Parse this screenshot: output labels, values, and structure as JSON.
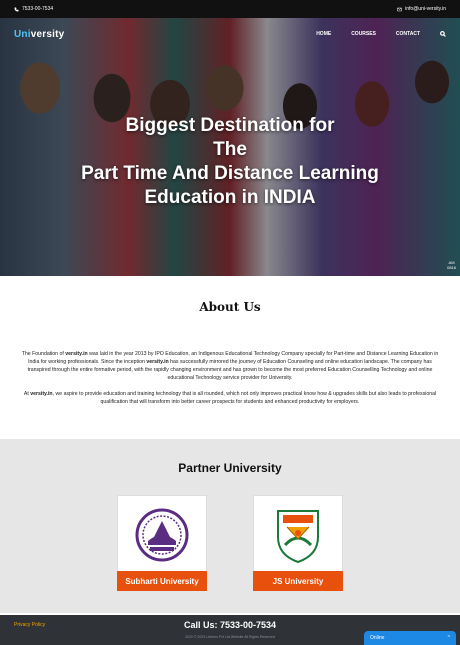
{
  "topbar": {
    "phone": "7533-00-7534",
    "email": "info@uni-versity.in"
  },
  "nav": {
    "logo_accent": "Uni",
    "logo_rest": "versity",
    "items": [
      "HOME",
      "COURSES",
      "CONTACT"
    ]
  },
  "hero": {
    "headline_lines": [
      "Biggest Destination for",
      "The",
      "Part Time And Distance Learning",
      "Education in INDIA"
    ],
    "badge_line1": "AM",
    "badge_line2": "0816"
  },
  "about": {
    "title": "About Us",
    "p1_prefix": "The Foundation of ",
    "p1_brand": "versity.in",
    "p1_mid": " was laid in the year 2013 by IPO Education, an Indigenous Educational Technology Company specially for Part-time and Distance Learning Education in India for working professionals. Since the inception ",
    "p1_brand2": "versity.in",
    "p1_rest": " has successfully mirrored the journey of Education Counseling and online education landscape. The company has transpired through the entire formative period, with the rapidly changing environment and has grown to become the most preferred Education Counselling Technology and online educational Technology service provider for University.",
    "p2_prefix": "At ",
    "p2_brand": "versity.in",
    "p2_rest": ", we aspire to provide education and training technology that is all rounded, which not only improves practical know how & upgrades skills but also leads to professional qualification that will transform into better career prospects for students and enhanced productivity for employers."
  },
  "partners": {
    "title": "Partner University",
    "items": [
      {
        "name": "Subharti University",
        "logo": "subharti-emblem-icon"
      },
      {
        "name": "JS University",
        "logo": "js-university-crest-icon"
      }
    ]
  },
  "footer": {
    "privacy": "Privacy Policy",
    "call": "Call Us: 7533-00-7534",
    "copyright": "2020 © 2023 Univers Pvt Ltd Website All Rights Reserved"
  },
  "chat": {
    "label": "Online",
    "toggle": "^"
  },
  "colors": {
    "accent_orange": "#e8500e",
    "logo_accent": "#4fc3f7",
    "footer_bg": "#2f3338",
    "chat_blue": "#1e88e5"
  }
}
